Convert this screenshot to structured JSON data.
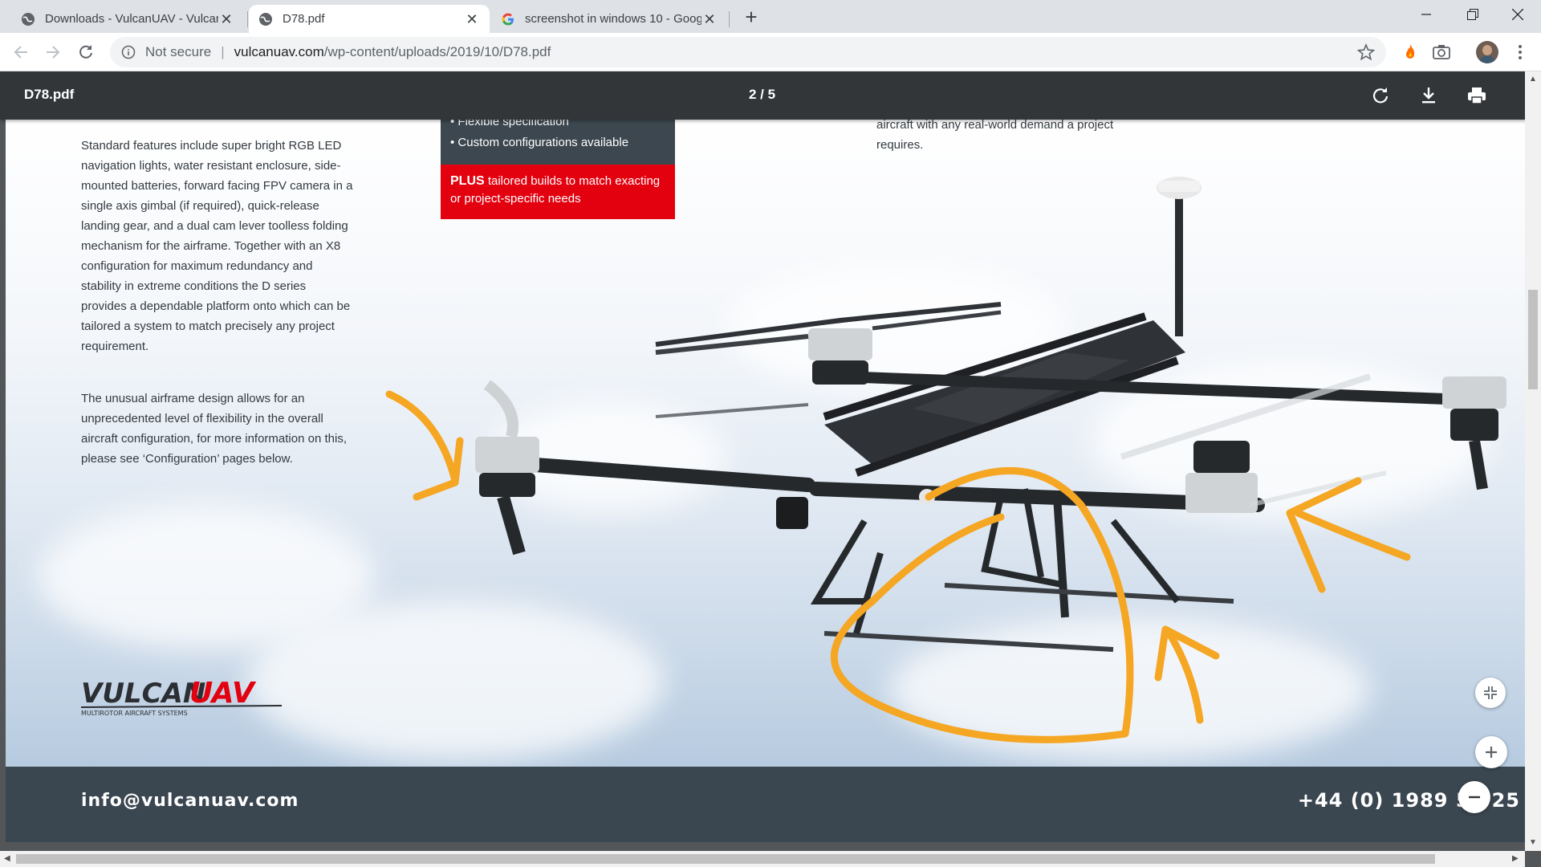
{
  "browser": {
    "tabs": [
      {
        "title": "Downloads - VulcanUAV - Vulcan",
        "active": false
      },
      {
        "title": "D78.pdf",
        "active": true
      },
      {
        "title": "screenshot in windows 10 - Goog",
        "active": false
      }
    ],
    "address": {
      "security_label": "Not secure",
      "separator": "|",
      "host": "vulcanuav.com",
      "path": "/wp-content/uploads/2019/10/D78.pdf"
    }
  },
  "pdf": {
    "filename": "D78.pdf",
    "page_indicator": "2 / 5"
  },
  "document": {
    "paragraph1": "Standard features include super bright RGB LED navigation lights, water resistant enclosure, side-mounted batteries, forward facing FPV camera in a single axis gimbal (if required), quick-release landing gear, and a dual cam lever toolless folding mechanism for the airframe. Together with an X8 configuration for maximum redundancy and stability in extreme conditions the  D series provides a dependable platform onto which can be tailored a system to match precisely any project requirement.",
    "paragraph2": "The unusual airframe design allows for an unprecedented level of flexibility in the overall aircraft configuration, for more information on this, please see ‘Configuration’ pages below.",
    "spec_items": [
      "• Flexible specification",
      "• Custom configurations available"
    ],
    "plus_bold": "PLUS",
    "plus_text": " tailored builds to match exacting or project-specific needs",
    "right_text": "aircraft with any real-world demand a project requires.",
    "logo_text_vulcan": "VULCAN",
    "logo_text_uav": "UAV",
    "logo_tagline": "MULTIROTOR AIRCRAFT SYSTEMS",
    "footer_email": "info@vulcanuav.com",
    "footer_phone": "+44 (0) 1989 55 25"
  },
  "colors": {
    "annotation": "#f5a623",
    "brand_red": "#e3000f",
    "footer_bg": "#3a4650"
  }
}
